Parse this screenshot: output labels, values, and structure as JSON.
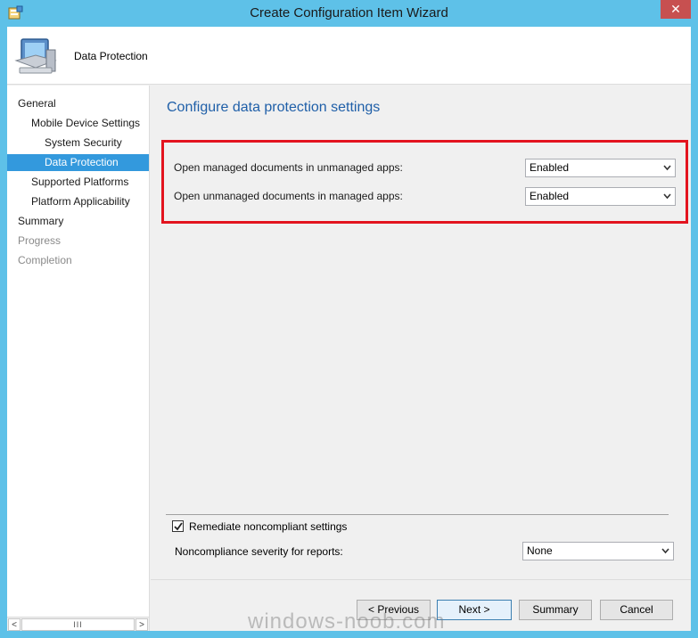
{
  "window": {
    "title": "Create Configuration Item Wizard",
    "close_glyph": "✕"
  },
  "header": {
    "title": "Data Protection",
    "icon": "computer-icon"
  },
  "sidebar": {
    "items": [
      {
        "label": "General",
        "level": 0,
        "state": "normal"
      },
      {
        "label": "Mobile Device Settings",
        "level": 1,
        "state": "normal"
      },
      {
        "label": "System Security",
        "level": 2,
        "state": "normal"
      },
      {
        "label": "Data Protection",
        "level": 2,
        "state": "selected"
      },
      {
        "label": "Supported Platforms",
        "level": 1,
        "state": "normal"
      },
      {
        "label": "Platform Applicability",
        "level": 1,
        "state": "normal"
      },
      {
        "label": "Summary",
        "level": 0,
        "state": "normal"
      },
      {
        "label": "Progress",
        "level": 0,
        "state": "disabled"
      },
      {
        "label": "Completion",
        "level": 0,
        "state": "disabled"
      }
    ],
    "scroll_left": "<",
    "scroll_thumb": "III",
    "scroll_right": ">"
  },
  "main": {
    "title": "Configure data protection settings",
    "settings": [
      {
        "label": "Open managed documents in unmanaged apps:",
        "value": "Enabled"
      },
      {
        "label": "Open unmanaged documents in managed apps:",
        "value": "Enabled"
      }
    ],
    "remediate_label": "Remediate noncompliant settings",
    "remediate_checked": true,
    "severity_label": "Noncompliance severity for reports:",
    "severity_value": "None"
  },
  "buttons": {
    "previous": "< Previous",
    "next": "Next >",
    "summary": "Summary",
    "cancel": "Cancel"
  },
  "watermark": "windows-noob.com",
  "colors": {
    "titlebar": "#5ec1e8",
    "selected": "#3399dd",
    "highlight_border": "#e3141f",
    "heading": "#1f5fa8"
  }
}
